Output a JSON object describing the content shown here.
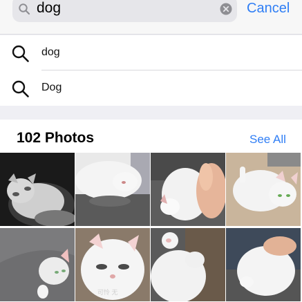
{
  "search": {
    "query": "dog",
    "cancel_label": "Cancel"
  },
  "suggestions": [
    {
      "label": "dog"
    },
    {
      "label": "Dog"
    }
  ],
  "photos": {
    "title": "102 Photos",
    "see_all_label": "See All",
    "caption_tile_6": "可怜 无"
  },
  "colors": {
    "accent": "#2f7ef5",
    "background": "#efeff4"
  },
  "icons": [
    "magnifier-icon",
    "clear-icon",
    "search-suggestion-icon"
  ]
}
